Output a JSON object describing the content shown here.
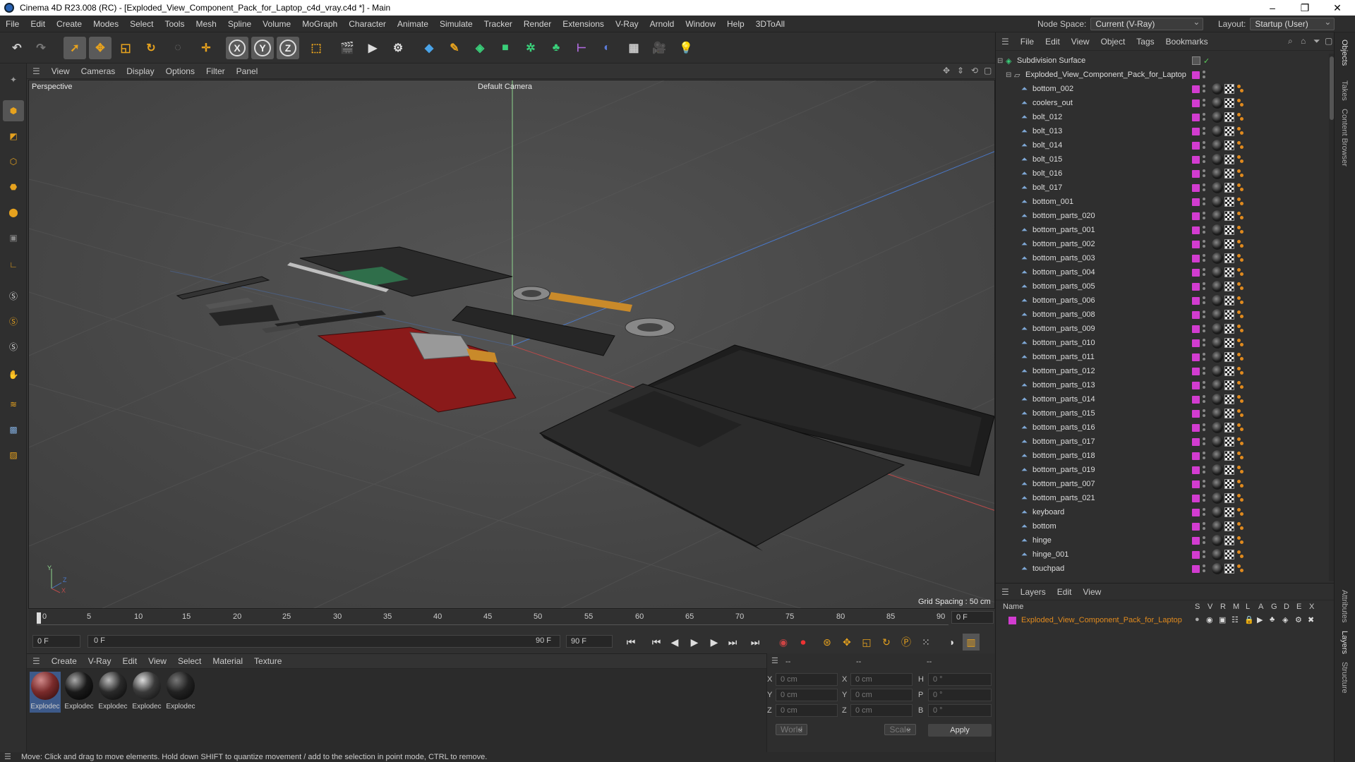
{
  "window": {
    "title": "Cinema 4D R23.008 (RC) - [Exploded_View_Component_Pack_for_Laptop_c4d_vray.c4d *] - Main"
  },
  "menubar": {
    "items": [
      "File",
      "Edit",
      "Create",
      "Modes",
      "Select",
      "Tools",
      "Mesh",
      "Spline",
      "Volume",
      "MoGraph",
      "Character",
      "Animate",
      "Simulate",
      "Tracker",
      "Render",
      "Extensions",
      "V-Ray",
      "Arnold",
      "Window",
      "Help",
      "3DToAll"
    ],
    "node_space_label": "Node Space:",
    "node_space_value": "Current (V-Ray)",
    "layout_label": "Layout:",
    "layout_value": "Startup (User)"
  },
  "toolbar": {
    "axis_x": "X",
    "axis_y": "Y",
    "axis_z": "Z"
  },
  "viewport": {
    "menu": [
      "View",
      "Cameras",
      "Display",
      "Options",
      "Filter",
      "Panel"
    ],
    "mode_label": "Perspective",
    "camera_label": "Default Camera",
    "grid_spacing": "Grid Spacing : 50 cm",
    "axis_y": "Y",
    "axis_z": "Z",
    "axis_x": "X"
  },
  "timeline": {
    "ticks": [
      "0",
      "5",
      "10",
      "15",
      "20",
      "25",
      "30",
      "35",
      "40",
      "45",
      "50",
      "55",
      "60",
      "65",
      "70",
      "75",
      "80",
      "85",
      "90"
    ],
    "current_frame": "0 F",
    "start_field": "0 F",
    "range_start": "0 F",
    "range_end": "90 F",
    "end_field": "90 F"
  },
  "materials": {
    "menu": [
      "Create",
      "V-Ray",
      "Edit",
      "View",
      "Select",
      "Material",
      "Texture"
    ],
    "items": [
      {
        "label": "Explodec",
        "color": "#7a2b2b"
      },
      {
        "label": "Explodec",
        "color": "#1a1a1a"
      },
      {
        "label": "Explodec",
        "color": "#2a2a2a"
      },
      {
        "label": "Explodec",
        "color": "#3a3a3a"
      },
      {
        "label": "Explodec",
        "color": "#222222"
      }
    ]
  },
  "attributes": {
    "header": [
      "--",
      "--",
      "--"
    ],
    "rows": [
      {
        "l1": "X",
        "v1": "0 cm",
        "l2": "X",
        "v2": "0 cm",
        "l3": "H",
        "v3": "0 °"
      },
      {
        "l1": "Y",
        "v1": "0 cm",
        "l2": "Y",
        "v2": "0 cm",
        "l3": "P",
        "v3": "0 °"
      },
      {
        "l1": "Z",
        "v1": "0 cm",
        "l2": "Z",
        "v2": "0 cm",
        "l3": "B",
        "v3": "0 °"
      }
    ],
    "coord_system": "World",
    "mode": "Scale",
    "apply": "Apply"
  },
  "status": {
    "text": "Move: Click and drag to move elements. Hold down SHIFT to quantize movement / add to the selection in point mode, CTRL to remove."
  },
  "objects": {
    "menu": [
      "File",
      "Edit",
      "View",
      "Object",
      "Tags",
      "Bookmarks"
    ],
    "root": "Subdivision Surface",
    "group": "Exploded_View_Component_Pack_for_Laptop",
    "items": [
      "bottom_002",
      "coolers_out",
      "bolt_012",
      "bolt_013",
      "bolt_014",
      "bolt_015",
      "bolt_016",
      "bolt_017",
      "bottom_001",
      "bottom_parts_020",
      "bottom_parts_001",
      "bottom_parts_002",
      "bottom_parts_003",
      "bottom_parts_004",
      "bottom_parts_005",
      "bottom_parts_006",
      "bottom_parts_008",
      "bottom_parts_009",
      "bottom_parts_010",
      "bottom_parts_011",
      "bottom_parts_012",
      "bottom_parts_013",
      "bottom_parts_014",
      "bottom_parts_015",
      "bottom_parts_016",
      "bottom_parts_017",
      "bottom_parts_018",
      "bottom_parts_019",
      "bottom_parts_007",
      "bottom_parts_021",
      "keyboard",
      "bottom",
      "hinge",
      "hinge_001",
      "touchpad"
    ]
  },
  "layers": {
    "menu": [
      "Layers",
      "Edit",
      "View"
    ],
    "col_name": "Name",
    "col_flags": [
      "S",
      "V",
      "R",
      "M",
      "L",
      "A",
      "G",
      "D",
      "E",
      "X"
    ],
    "layer_name": "Exploded_View_Component_Pack_for_Laptop"
  },
  "side_tabs": [
    "Objects",
    "Takes",
    "Content Browser",
    "Attributes",
    "Layers",
    "Structure"
  ]
}
